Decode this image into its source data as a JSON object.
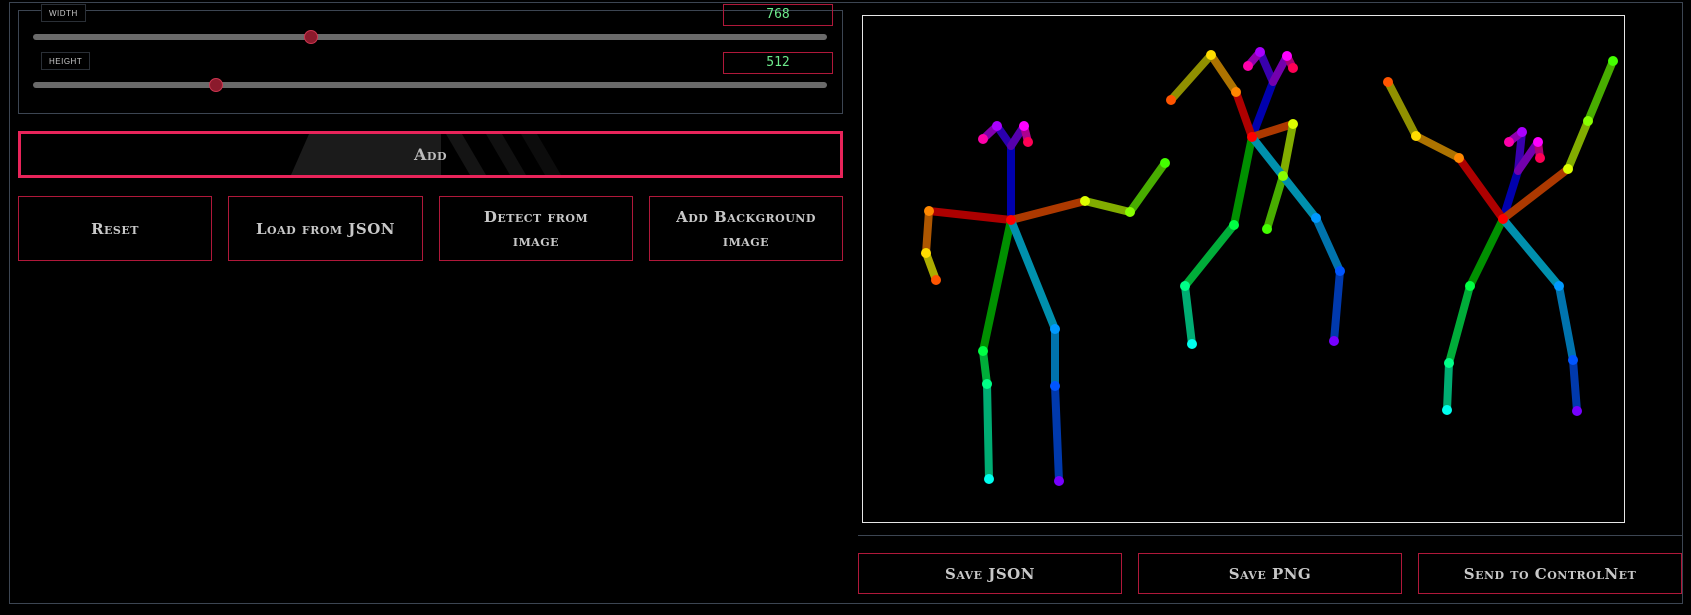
{
  "dimensions": {
    "width": {
      "label": "width",
      "value": "768",
      "fraction": 0.35
    },
    "height": {
      "label": "height",
      "value": "512",
      "fraction": 0.23
    }
  },
  "actions": {
    "add_label": "Add",
    "reset_label": "Reset",
    "load_json_label": "Load from JSON",
    "detect_label": "Detect from image",
    "add_background_label": "Add Background image"
  },
  "canvas": {
    "background": "#000000",
    "border": "#e6e6e6"
  },
  "footer": {
    "save_json_label": "Save JSON",
    "save_png_label": "Save PNG",
    "send_controlnet_label": "Send to ControlNet"
  },
  "colors": {
    "accent": "#e8245a",
    "border_red": "#b0183a",
    "value_green": "#6dea8c"
  }
}
